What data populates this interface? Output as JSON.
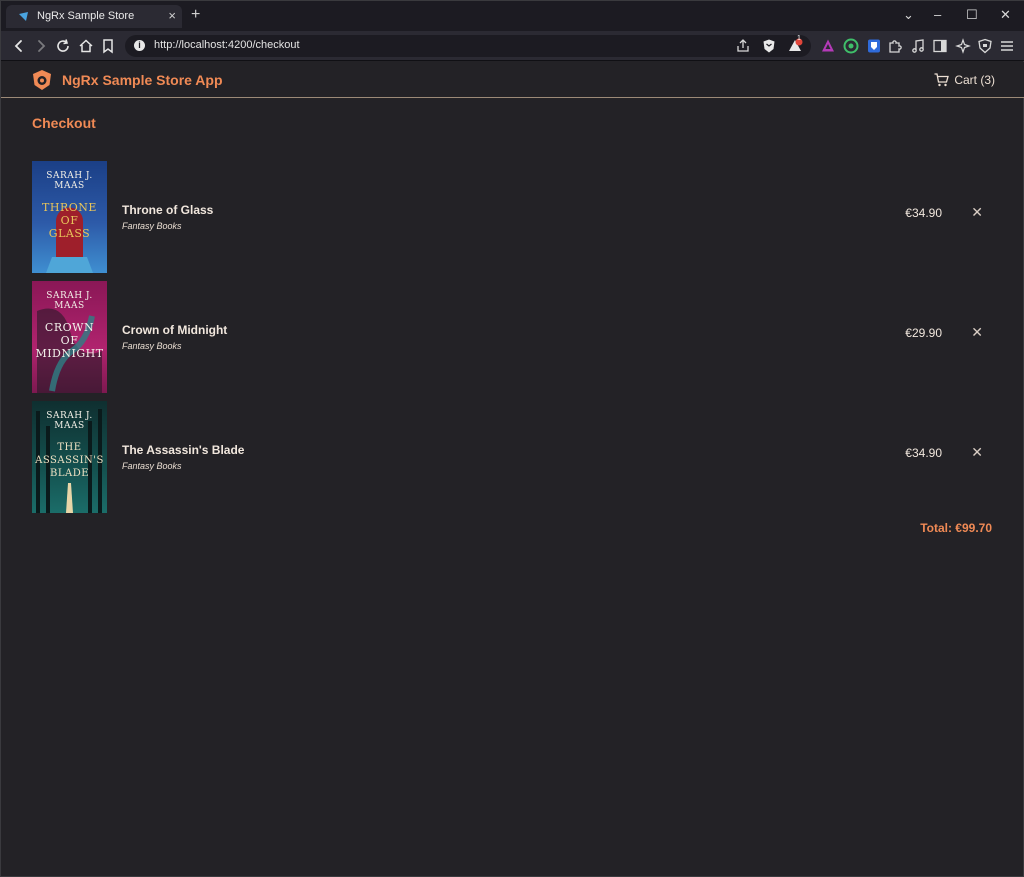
{
  "browser": {
    "tab_title": "NgRx Sample Store",
    "tab_close": "×",
    "new_tab": "+",
    "url": "http://localhost:4200/checkout",
    "info_glyph": "i",
    "window_controls": {
      "dropdown": "⌄",
      "minimize": "–",
      "maximize": "☐",
      "close": "✕"
    },
    "extensions": [
      "share-icon",
      "brave-shield-icon",
      "rewards-icon",
      "ext-purple-icon",
      "ext-green-icon",
      "bitwarden-icon",
      "puzzle-icon",
      "music-icon",
      "sidebar-icon",
      "leo-icon",
      "vpn-icon",
      "menu-icon"
    ],
    "rewards_badge": "1"
  },
  "header": {
    "app_title": "NgRx Sample Store App",
    "cart_label": "Cart (3)"
  },
  "checkout": {
    "title": "Checkout",
    "items": [
      {
        "name": "Throne of Glass",
        "category": "Fantasy Books",
        "price": "€34.90",
        "remove": "✕",
        "cover_author": "SARAH J.\nMAAS",
        "cover_title": "THRONE\nOF\nGLASS",
        "cover_bg": "#2d5aa8",
        "cover_fg": "#e8c55a"
      },
      {
        "name": "Crown of Midnight",
        "category": "Fantasy Books",
        "price": "€29.90",
        "remove": "✕",
        "cover_author": "SARAH J.\nMAAS",
        "cover_title": "CROWN\nOF\nMIDNIGHT",
        "cover_bg": "#b0236e",
        "cover_fg": "#f2f0ea"
      },
      {
        "name": "The Assassin's Blade",
        "category": "Fantasy Books",
        "price": "€34.90",
        "remove": "✕",
        "cover_author": "SARAH J.\nMAAS",
        "cover_title": "THE\nASSASSIN'S\nBLADE",
        "cover_bg": "#14514f",
        "cover_fg": "#f0e3c4"
      }
    ],
    "total": "Total: €99.70"
  },
  "colors": {
    "accent": "#f08a55",
    "background": "#232226",
    "text": "#f1e7dd"
  }
}
